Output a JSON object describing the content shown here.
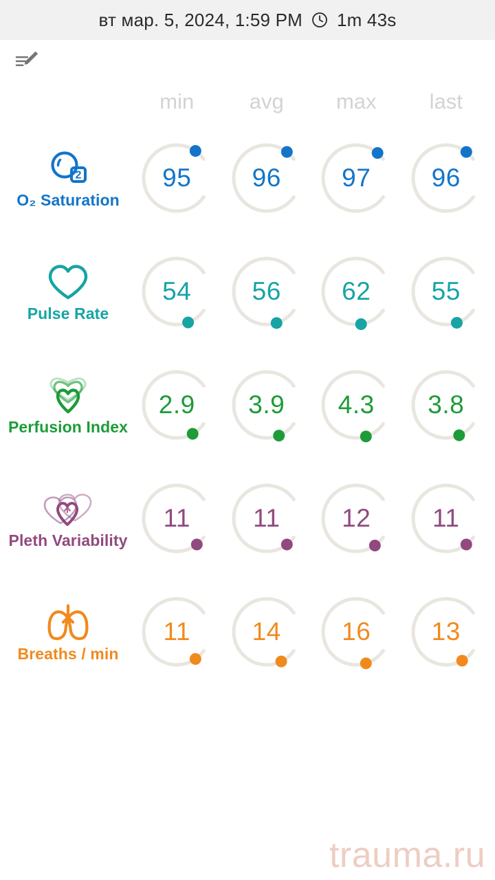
{
  "header": {
    "datetime": "вт мар. 5, 2024, 1:59 PM",
    "clock_icon": "clock-icon",
    "duration": "1m 43s"
  },
  "toolbar": {
    "edit_note_icon": "edit-note-icon"
  },
  "table": {
    "columns": [
      {
        "key": "min",
        "label": "min"
      },
      {
        "key": "avg",
        "label": "avg"
      },
      {
        "key": "max",
        "label": "max"
      },
      {
        "key": "last",
        "label": "last"
      }
    ],
    "header_color": "#d3d3d3",
    "track_color": "#e9e6e0",
    "rows": [
      {
        "name": "O₂ Saturation",
        "icon": "o2-bubble-icon",
        "color": "#1275c9",
        "values": [
          "95",
          "96",
          "97",
          "96"
        ],
        "gauge_fractions": [
          0.93,
          0.94,
          0.95,
          0.94
        ]
      },
      {
        "name": "Pulse Rate",
        "icon": "heart-outline-icon",
        "color": "#16a4a4",
        "values": [
          "54",
          "56",
          "62",
          "55"
        ],
        "gauge_fractions": [
          0.12,
          0.13,
          0.16,
          0.125
        ]
      },
      {
        "name": "Perfusion Index",
        "icon": "triple-heart-icon",
        "color": "#1d9b38",
        "values": [
          "2.9",
          "3.9",
          "4.3",
          "3.8"
        ],
        "gauge_fractions": [
          0.09,
          0.115,
          0.13,
          0.11
        ]
      },
      {
        "name": "Pleth Variability",
        "icon": "double-heart-icon",
        "color": "#91497e",
        "values": [
          "11",
          "11",
          "12",
          "11"
        ],
        "gauge_fractions": [
          0.06,
          0.06,
          0.07,
          0.06
        ]
      },
      {
        "name": "Breaths / min",
        "icon": "lungs-icon",
        "color": "#f18a1e",
        "values": [
          "11",
          "14",
          "16",
          "13"
        ],
        "gauge_fractions": [
          0.07,
          0.1,
          0.13,
          0.09
        ]
      }
    ]
  },
  "watermark": {
    "text": "trauma.ru",
    "color": "#eecdc2"
  }
}
